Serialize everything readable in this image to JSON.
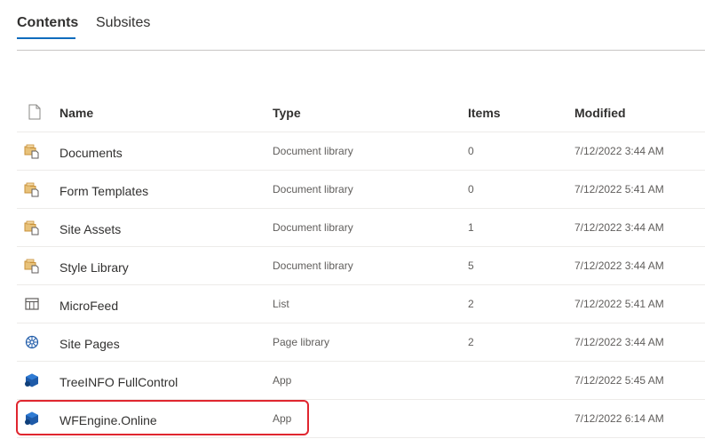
{
  "tabs": [
    {
      "label": "Contents",
      "active": true
    },
    {
      "label": "Subsites",
      "active": false
    }
  ],
  "columns": {
    "name": "Name",
    "type": "Type",
    "items": "Items",
    "modified": "Modified"
  },
  "rows": [
    {
      "name": "Documents",
      "type": "Document library",
      "items": "0",
      "modified": "7/12/2022 3:44 AM",
      "icon": "document-library-icon"
    },
    {
      "name": "Form Templates",
      "type": "Document library",
      "items": "0",
      "modified": "7/12/2022 5:41 AM",
      "icon": "document-library-icon"
    },
    {
      "name": "Site Assets",
      "type": "Document library",
      "items": "1",
      "modified": "7/12/2022 3:44 AM",
      "icon": "document-library-icon"
    },
    {
      "name": "Style Library",
      "type": "Document library",
      "items": "5",
      "modified": "7/12/2022 3:44 AM",
      "icon": "document-library-icon"
    },
    {
      "name": "MicroFeed",
      "type": "List",
      "items": "2",
      "modified": "7/12/2022 5:41 AM",
      "icon": "list-icon"
    },
    {
      "name": "Site Pages",
      "type": "Page library",
      "items": "2",
      "modified": "7/12/2022 3:44 AM",
      "icon": "page-library-icon"
    },
    {
      "name": "TreeINFO FullControl",
      "type": "App",
      "items": "",
      "modified": "7/12/2022 5:45 AM",
      "icon": "app-icon"
    },
    {
      "name": "WFEngine.Online",
      "type": "App",
      "items": "",
      "modified": "7/12/2022 6:14 AM",
      "icon": "app-icon"
    }
  ],
  "colors": {
    "accent": "#0f6cbd",
    "highlight": "#e0262f",
    "folder": "#c8913a",
    "app": "#1e5aa8"
  }
}
